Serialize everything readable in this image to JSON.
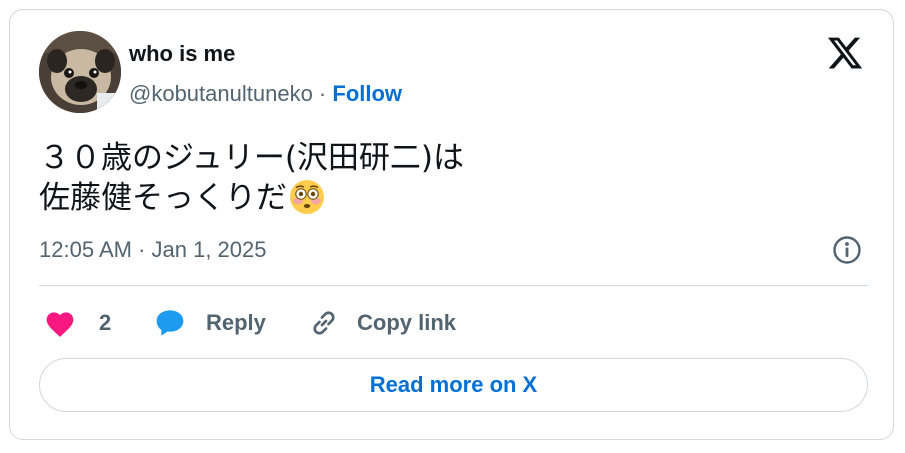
{
  "user": {
    "display_name": "who is me",
    "handle": "@kobutanultuneko",
    "separator": " · ",
    "follow_label": "Follow",
    "avatar_icon": "pug-avatar"
  },
  "tweet": {
    "lines": [
      "３０歳のジュリー(沢田研二)は",
      "佐藤健そっくりだ"
    ],
    "emoji_icon": "flushed-face-emoji",
    "timestamp": "12:05 AM · Jan 1, 2025"
  },
  "actions": {
    "like_count": "2",
    "reply_label": "Reply",
    "copy_link_label": "Copy link"
  },
  "read_more_label": "Read more on X",
  "colors": {
    "link": "#006fd6",
    "like": "#f91880",
    "reply": "#1d9bf0",
    "secondary_text": "#536471",
    "border": "#cfd9de"
  }
}
